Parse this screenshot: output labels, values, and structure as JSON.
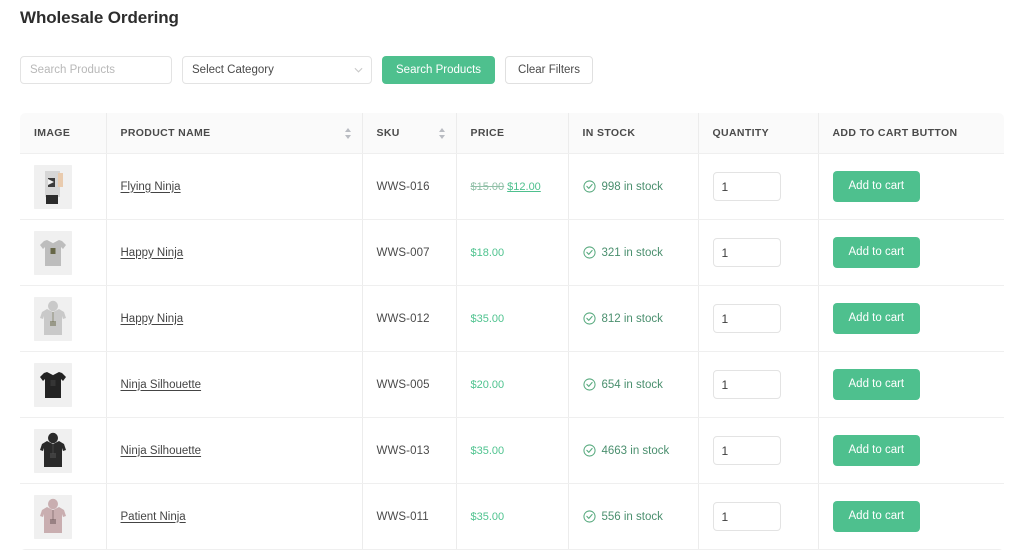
{
  "page": {
    "title": "Wholesale Ordering"
  },
  "filters": {
    "search_placeholder": "Search Products",
    "search_value": "",
    "category_selected": "Select Category",
    "search_button": "Search Products",
    "clear_button": "Clear Filters"
  },
  "table": {
    "columns": [
      {
        "label": "IMAGE",
        "sortable": false
      },
      {
        "label": "PRODUCT NAME",
        "sortable": true
      },
      {
        "label": "SKU",
        "sortable": true
      },
      {
        "label": "PRICE",
        "sortable": false
      },
      {
        "label": "IN STOCK",
        "sortable": false
      },
      {
        "label": "QUANTITY",
        "sortable": false
      },
      {
        "label": "ADD TO CART BUTTON",
        "sortable": false
      }
    ],
    "rows": [
      {
        "name": "Flying Ninja",
        "sku": "WWS-016",
        "price_old": "$15.00",
        "price_new": "$12.00",
        "price": "",
        "stock": "998 in stock",
        "quantity": "1",
        "cart_button": "Add to cart",
        "thumb": "flying-ninja-tee"
      },
      {
        "name": "Happy Ninja",
        "sku": "WWS-007",
        "price_old": "",
        "price_new": "",
        "price": "$18.00",
        "stock": "321 in stock",
        "quantity": "1",
        "cart_button": "Add to cart",
        "thumb": "gray-tee"
      },
      {
        "name": "Happy Ninja",
        "sku": "WWS-012",
        "price_old": "",
        "price_new": "",
        "price": "$35.00",
        "stock": "812 in stock",
        "quantity": "1",
        "cart_button": "Add to cart",
        "thumb": "light-hoodie"
      },
      {
        "name": "Ninja Silhouette",
        "sku": "WWS-005",
        "price_old": "",
        "price_new": "",
        "price": "$20.00",
        "stock": "654 in stock",
        "quantity": "1",
        "cart_button": "Add to cart",
        "thumb": "black-tee"
      },
      {
        "name": "Ninja Silhouette",
        "sku": "WWS-013",
        "price_old": "",
        "price_new": "",
        "price": "$35.00",
        "stock": "4663 in stock",
        "quantity": "1",
        "cart_button": "Add to cart",
        "thumb": "dark-hoodie"
      },
      {
        "name": "Patient Ninja",
        "sku": "WWS-011",
        "price_old": "",
        "price_new": "",
        "price": "$35.00",
        "stock": "556 in stock",
        "quantity": "1",
        "cart_button": "Add to cart",
        "thumb": "pink-hoodie"
      }
    ]
  },
  "colors": {
    "accent_green": "#4ec08e",
    "stock_text": "#4a8f6e",
    "price_green": "#4fc38f",
    "header_bg": "#fafafa",
    "border": "#efefef"
  }
}
